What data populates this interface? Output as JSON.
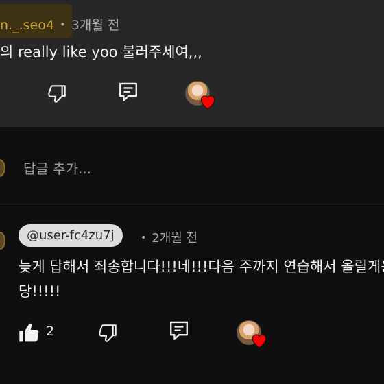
{
  "top_comment": {
    "author_handle": "n._.seo4",
    "separator": "•",
    "time": "3개월 전",
    "text": "의 really like yoo  불러주세여,,,"
  },
  "reply_input": {
    "placeholder": "답글 추가..."
  },
  "reply_comment": {
    "author_handle": "@user-fc4zu7j",
    "separator": "•",
    "time": "2개월 전",
    "text": "늦게 답해서 죄송합니다!!!네!!!다음 주까지 연습해서 올릴게용 당!!!!!",
    "like_count": "2"
  },
  "colors": {
    "background": "#0f0f0f",
    "highlight_panel": "#272727",
    "handle_gold": "#c9a635",
    "heart_red": "#ff0000",
    "chip_bg": "#dcdcdc"
  },
  "icons": [
    "dislike-icon",
    "reply-icon",
    "creator-heart-icon",
    "like-icon"
  ]
}
